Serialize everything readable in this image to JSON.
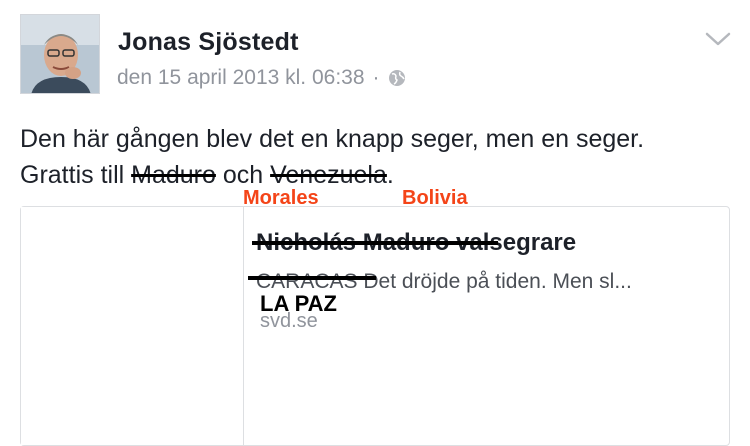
{
  "post": {
    "author": "Jonas Sjöstedt",
    "timestamp": "den 15 april 2013 kl. 06:38",
    "separator": "·",
    "text_before": "Den här gången blev det en knapp seger, men en seger. Grattis till ",
    "struck_name": "Maduro",
    "text_middle": " och ",
    "struck_country": "Venezuela",
    "text_after": ".",
    "privacy_icon": "globe-icon",
    "options_icon": "chevron-down-icon"
  },
  "corrections": {
    "name": "Morales",
    "country": "Bolivia",
    "city": "LA PAZ",
    "color": "#f44418"
  },
  "link_card": {
    "title_struck": "Nicholás Maduro",
    "title_rest": " valsegrare",
    "desc_struck": "CARACAS",
    "desc_rest": " Det dröjde på tiden. Men sl...",
    "domain": "svd.se"
  }
}
